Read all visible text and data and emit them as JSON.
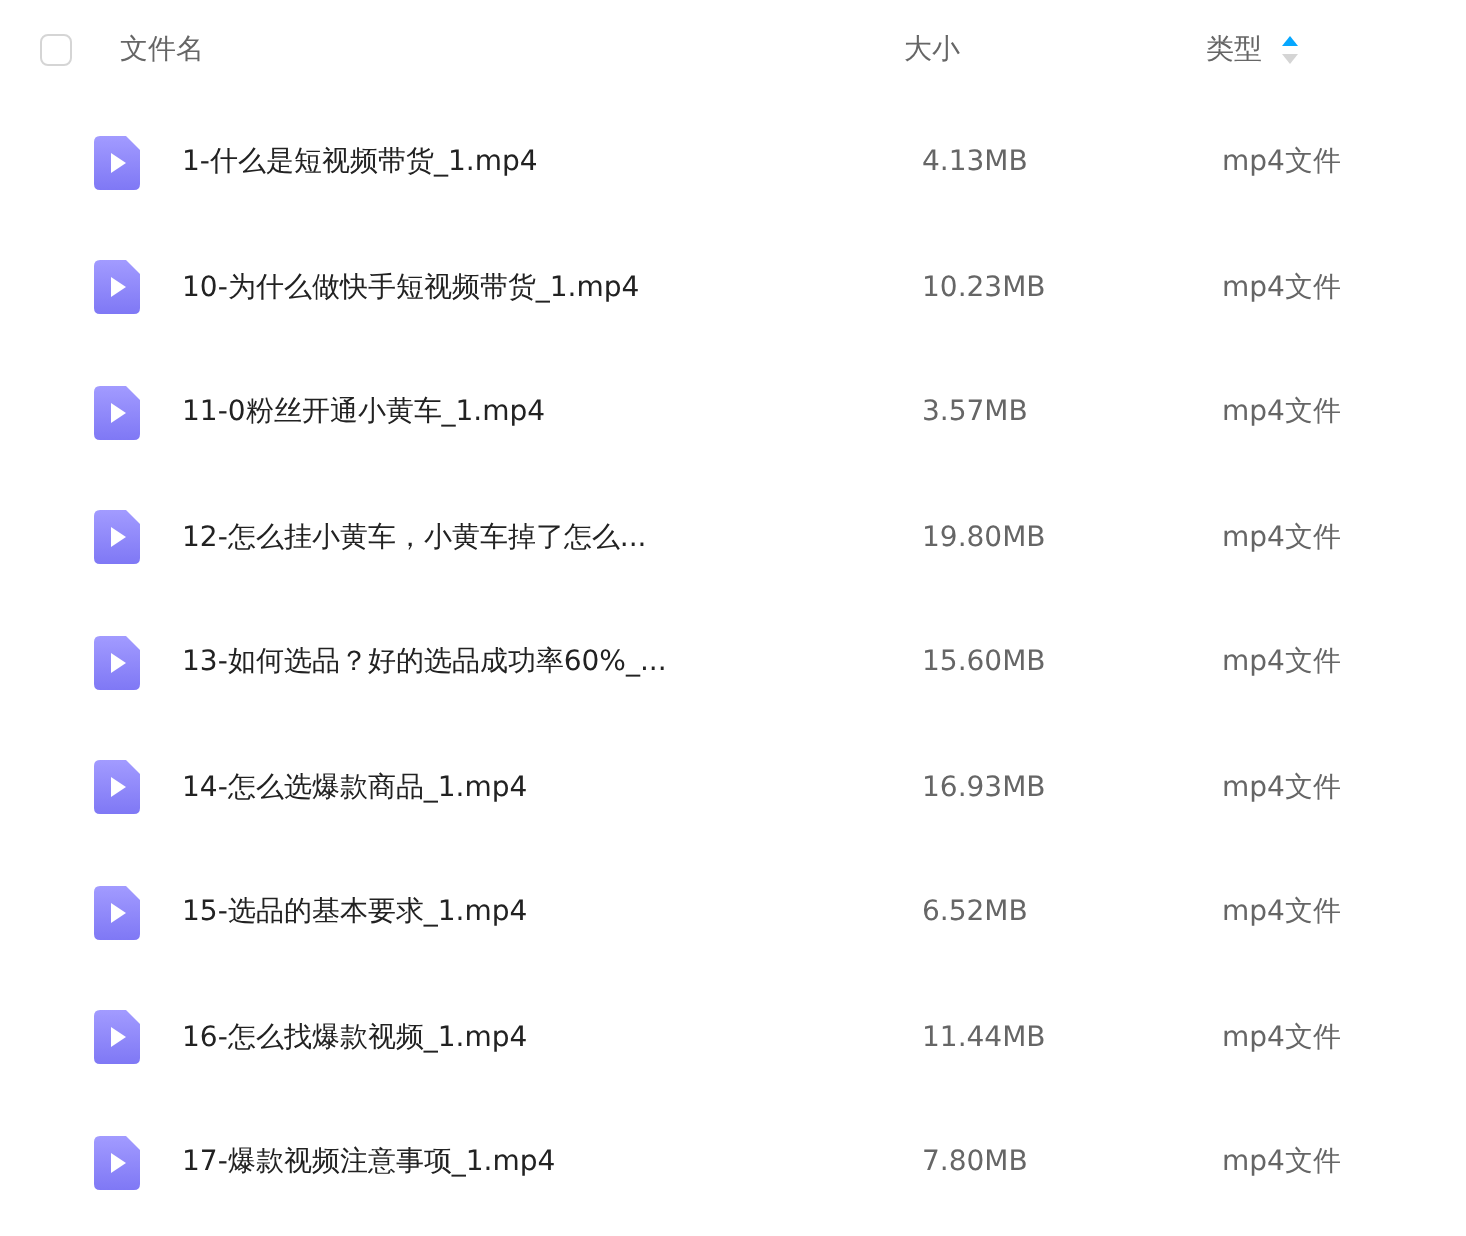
{
  "header": {
    "select_all": {
      "checked": false
    },
    "columns": [
      {
        "label": "文件名"
      },
      {
        "label": "大小"
      },
      {
        "label": "类型",
        "sort_ascending": true
      }
    ]
  },
  "files": [
    {
      "name": "1-什么是短视频带货_1.mp4",
      "size": "4.13MB",
      "type": "mp4文件"
    },
    {
      "name": "10-为什么做快手短视频带货_1.mp4",
      "size": "10.23MB",
      "type": "mp4文件"
    },
    {
      "name": "11-0粉丝开通小黄车_1.mp4",
      "size": "3.57MB",
      "type": "mp4文件"
    },
    {
      "name": "12-怎么挂小黄车，小黄车掉了怎么...",
      "size": "19.80MB",
      "type": "mp4文件"
    },
    {
      "name": "13-如何选品？好的选品成功率60%_...",
      "size": "15.60MB",
      "type": "mp4文件"
    },
    {
      "name": "14-怎么选爆款商品_1.mp4",
      "size": "16.93MB",
      "type": "mp4文件"
    },
    {
      "name": "15-选品的基本要求_1.mp4",
      "size": "6.52MB",
      "type": "mp4文件"
    },
    {
      "name": "16-怎么找爆款视频_1.mp4",
      "size": "11.44MB",
      "type": "mp4文件"
    },
    {
      "name": "17-爆款视频注意事项_1.mp4",
      "size": "7.80MB",
      "type": "mp4文件"
    }
  ]
}
